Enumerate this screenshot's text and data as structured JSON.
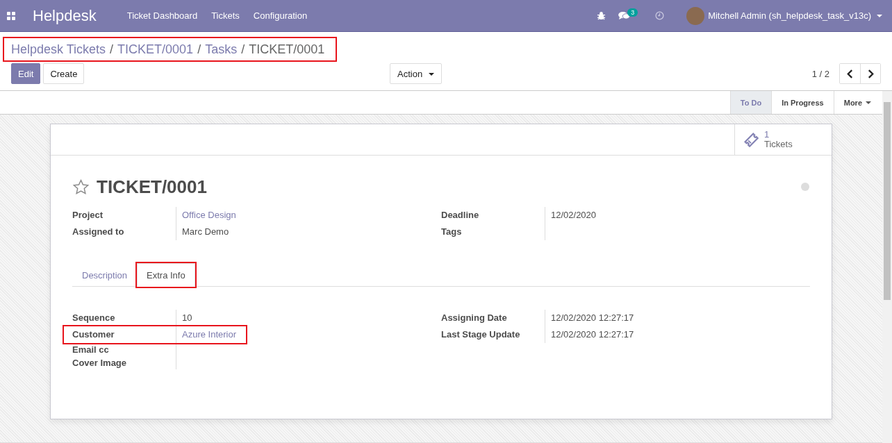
{
  "navbar": {
    "app_name": "Helpdesk",
    "menu": [
      "Ticket Dashboard",
      "Tickets",
      "Configuration"
    ],
    "message_count": "3",
    "user": "Mitchell Admin (sh_helpdesk_task_v13c)"
  },
  "breadcrumb": {
    "annotated": true,
    "separator": "/",
    "items": [
      "Helpdesk Tickets",
      "TICKET/0001",
      "Tasks",
      "TICKET/0001"
    ]
  },
  "buttons": {
    "edit": "Edit",
    "create": "Create",
    "action": "Action"
  },
  "pager": "1 / 2",
  "stages": [
    {
      "label": "To Do",
      "selected": true
    },
    {
      "label": "In Progress",
      "selected": false
    },
    {
      "label": "More",
      "selected": false
    }
  ],
  "smart_button": {
    "count": "1",
    "label": "Tickets"
  },
  "record": {
    "title": "TICKET/0001",
    "starred": false
  },
  "groups": [
    [
      {
        "label": "Project",
        "value": "Office Design",
        "kind": "link"
      },
      {
        "label": "Assigned to",
        "value": "Marc Demo",
        "kind": "text"
      }
    ],
    [
      {
        "label": "Deadline",
        "value": "12/02/2020",
        "kind": "text"
      },
      {
        "label": "Tags"
      }
    ]
  ],
  "tabs": [
    {
      "label": "Description",
      "selected": false,
      "annotated": false
    },
    {
      "label": "Extra Info",
      "selected": true,
      "annotated": true
    }
  ],
  "extra_groups": [
    [
      {
        "label": "Sequence",
        "value": "10",
        "kind": "text",
        "annotated": false
      },
      {
        "label": "Customer",
        "value": "Azure Interior",
        "kind": "link",
        "annotated": true
      },
      {
        "label": "Email cc",
        "annotated": false
      },
      {
        "label": "Cover Image",
        "annotated": false
      }
    ],
    [
      {
        "label": "Assigning Date",
        "value": "12/02/2020 12:27:17",
        "kind": "text",
        "annotated": false
      },
      {
        "label": "Last Stage Update",
        "value": "12/02/2020 12:27:17",
        "kind": "text",
        "annotated": false
      }
    ]
  ]
}
